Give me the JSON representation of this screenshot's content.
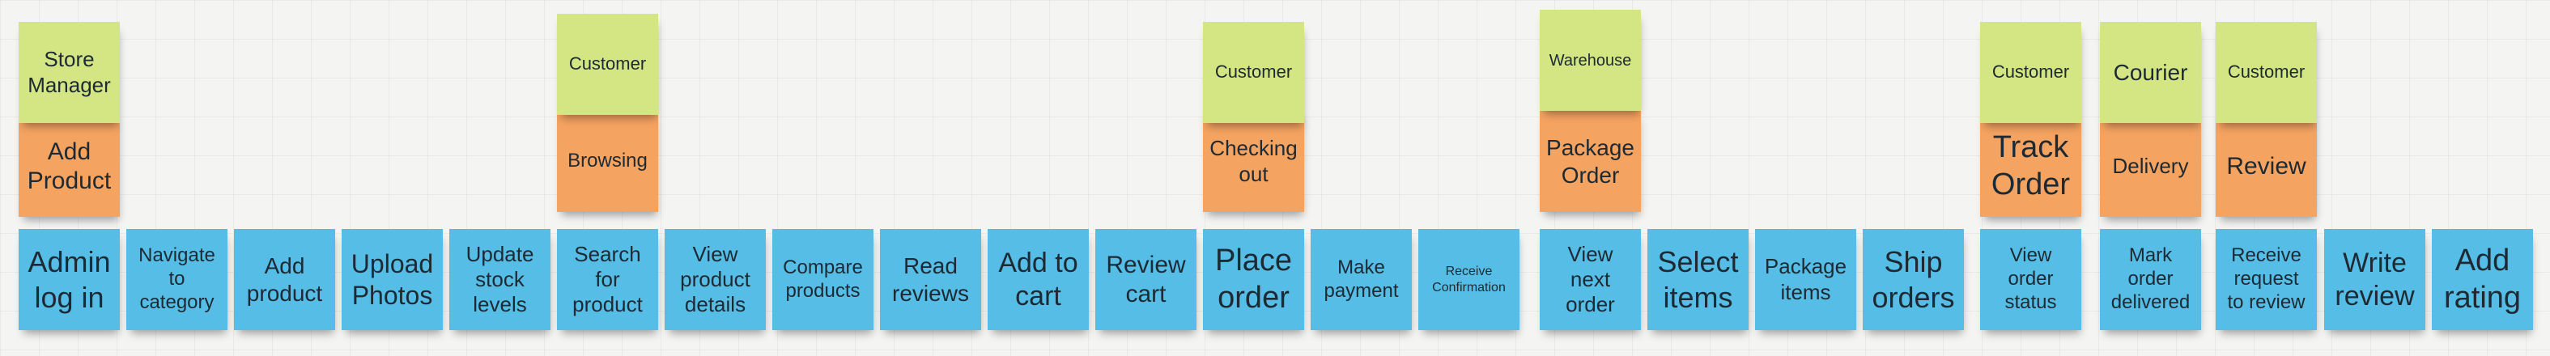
{
  "colors": {
    "event": "#55bde6",
    "command": "#f4a361",
    "actor": "#d4e584",
    "canvas": "#f4f4f3"
  },
  "events": [
    "Admin\nlog in",
    "Navigate\nto\ncategory",
    "Add\nproduct",
    "Upload\nPhotos",
    "Update\nstock\nlevels",
    "Search\nfor\nproduct",
    "View\nproduct\ndetails",
    "Compare\nproducts",
    "Read\nreviews",
    "Add to\ncart",
    "Review\ncart",
    "Place\norder",
    "Make\npayment",
    "Receive\nConfirmation",
    "View\nnext\norder",
    "Select\nitems",
    "Package\nitems",
    "Ship\norders",
    "View\norder\nstatus",
    "Mark\norder\ndelivered",
    "Receive\nrequest\nto review",
    "Write\nreview",
    "Add\nrating"
  ],
  "groups": [
    {
      "actor": "Store\nManager",
      "command": "Add\nProduct"
    },
    {
      "actor": "Customer",
      "command": "Browsing"
    },
    {
      "actor": "Customer",
      "command": "Checking\nout"
    },
    {
      "actor": "Warehouse",
      "command": "Package\nOrder"
    },
    {
      "actor": "Customer",
      "command": "Track\nOrder"
    },
    {
      "actor": "Courier",
      "command": "Delivery"
    },
    {
      "actor": "Customer",
      "command": "Review"
    }
  ]
}
